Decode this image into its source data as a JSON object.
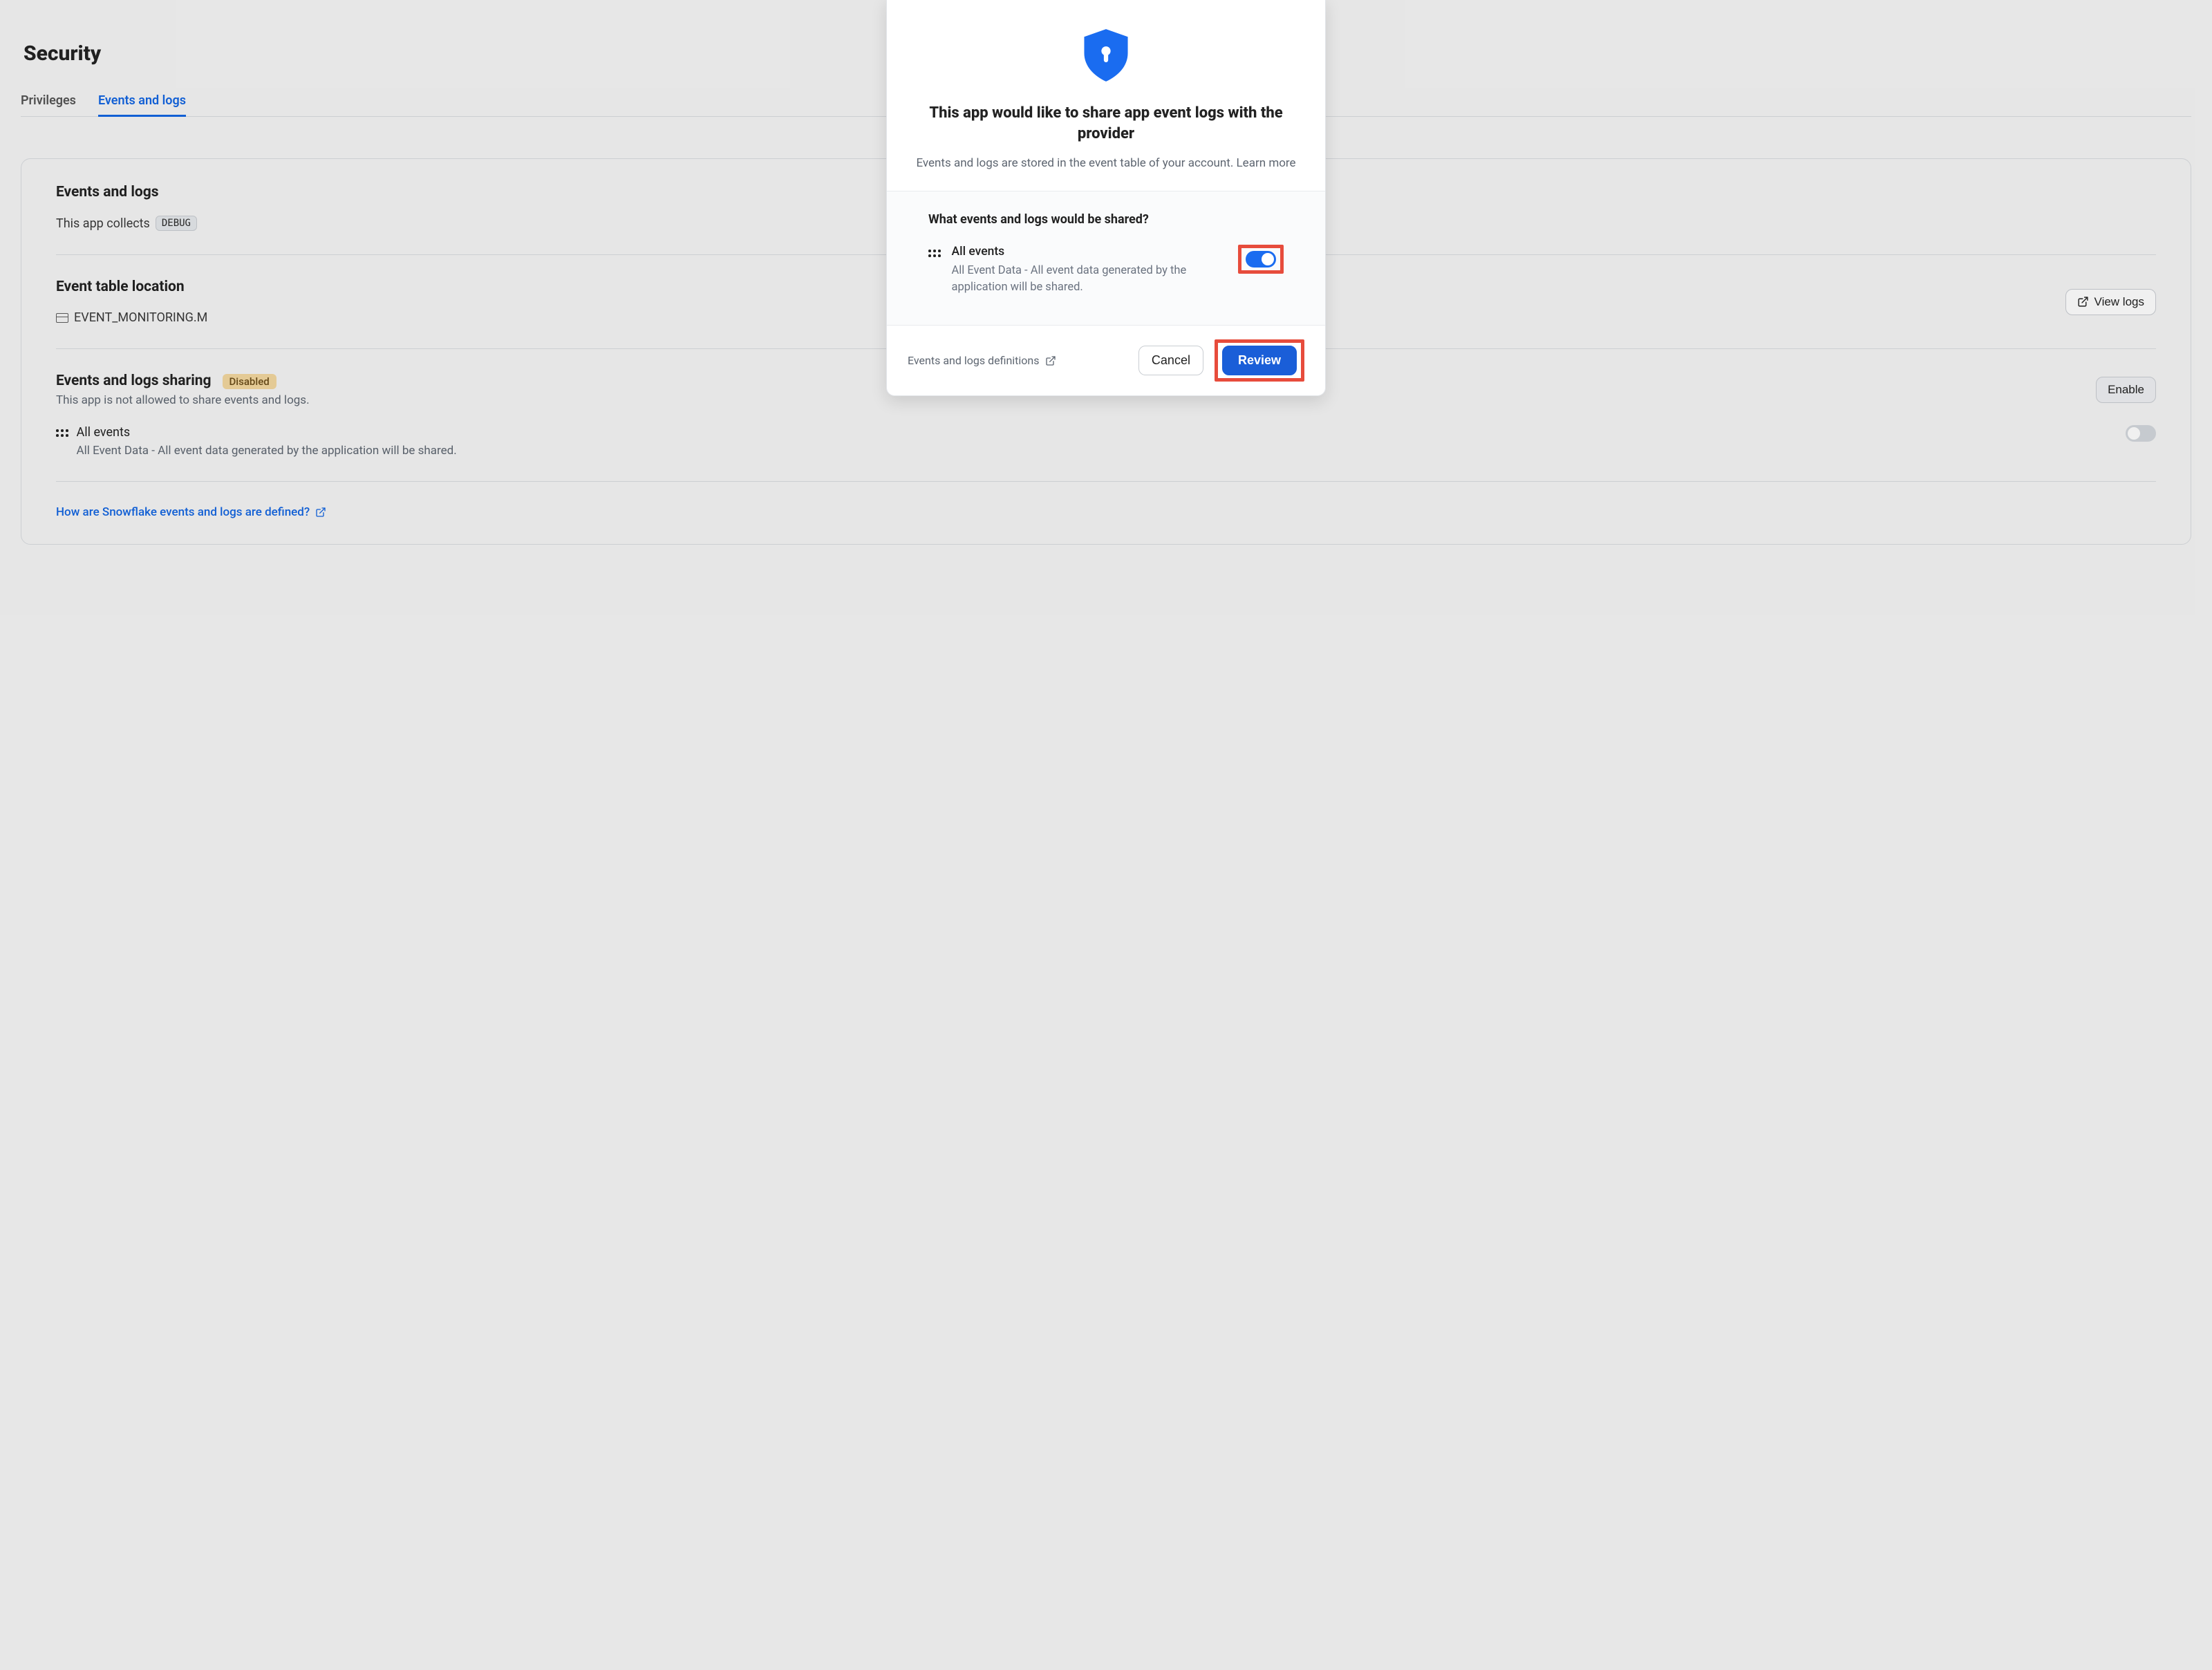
{
  "page": {
    "title": "Security",
    "tabs": [
      {
        "label": "Privileges",
        "active": false
      },
      {
        "label": "Events and logs",
        "active": true
      }
    ]
  },
  "card": {
    "section1_title": "Events and logs",
    "collects_prefix": "This app collects",
    "collects_level": "DEBUG",
    "section2_title": "Event table location",
    "view_logs_label": "View logs",
    "table_location": "EVENT_MONITORING.M",
    "section3_title": "Events and logs sharing",
    "sharing_status": "Disabled",
    "sharing_desc": "This app is not allowed to share events and logs.",
    "enable_label": "Enable",
    "item_title": "All events",
    "item_desc": "All Event Data - All event data generated by the application will be shared.",
    "help_link": "How are Snowflake events and logs are defined?"
  },
  "modal": {
    "title": "This app would like to share app event logs with the provider",
    "subtitle_prefix": "Events and logs are stored in the event table of your account. ",
    "subtitle_link": "Learn more",
    "question": "What events and logs would be shared?",
    "event_title": "All events",
    "event_desc": "All Event Data - All event data generated by the application will be shared.",
    "footer_link": "Events and logs definitions",
    "cancel": "Cancel",
    "review": "Review"
  },
  "colors": {
    "accent": "#1a6cf0",
    "highlight": "#e74c3c"
  }
}
